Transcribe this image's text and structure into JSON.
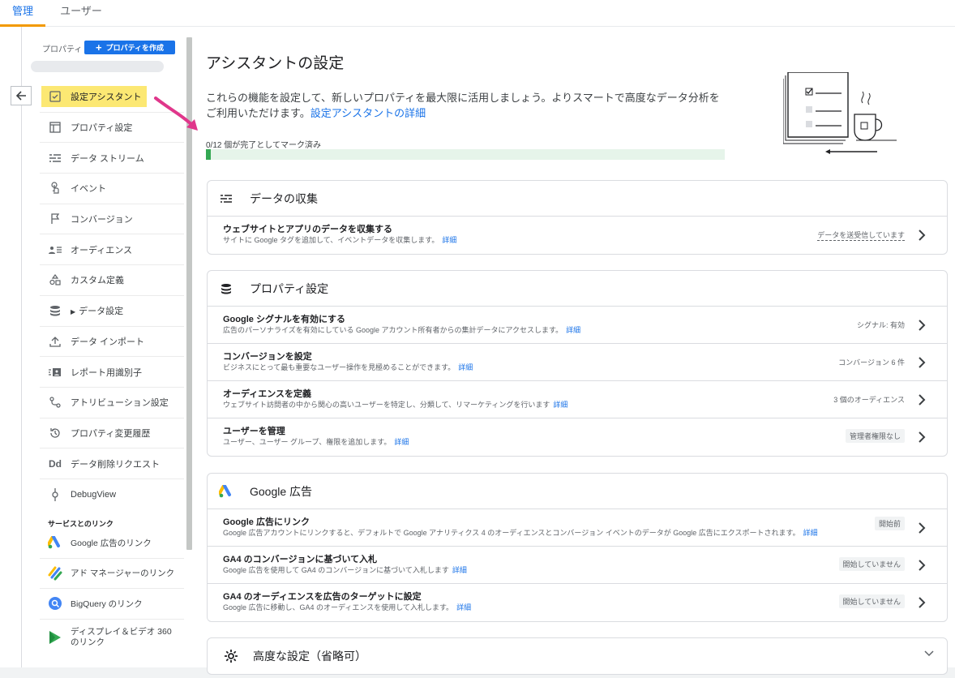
{
  "top_tabs": {
    "admin": "管理",
    "user": "ユーザー"
  },
  "sidebar": {
    "property_label": "プロパティ",
    "create_property": "プロパティを作成",
    "items": [
      {
        "label": "設定アシスタント",
        "icon": "checkbox-icon",
        "active": true
      },
      {
        "label": "プロパティ設定",
        "icon": "property-icon"
      },
      {
        "label": "データ ストリーム",
        "icon": "streams-icon"
      },
      {
        "label": "イベント",
        "icon": "touch-icon"
      },
      {
        "label": "コンバージョン",
        "icon": "flag-icon"
      },
      {
        "label": "オーディエンス",
        "icon": "audience-icon"
      },
      {
        "label": "カスタム定義",
        "icon": "shapes-icon"
      },
      {
        "label": "データ設定",
        "icon": "database-icon",
        "expandable": true
      },
      {
        "label": "データ インポート",
        "icon": "upload-icon"
      },
      {
        "label": "レポート用識別子",
        "icon": "identity-icon"
      },
      {
        "label": "アトリビューション設定",
        "icon": "attribution-icon"
      },
      {
        "label": "プロパティ変更履歴",
        "icon": "history-icon"
      },
      {
        "label": "データ削除リクエスト",
        "icon": "dd-icon"
      },
      {
        "label": "DebugView",
        "icon": "debug-icon"
      }
    ],
    "services_header": "サービスとのリンク",
    "services": [
      {
        "label": "Google 広告のリンク",
        "icon": "google-ads-icon"
      },
      {
        "label": "アド マネージャーのリンク",
        "icon": "ad-manager-icon"
      },
      {
        "label": "BigQuery のリンク",
        "icon": "bigquery-icon"
      },
      {
        "label_line1": "ディスプレイ＆ビデオ 360",
        "label_line2": "のリンク",
        "icon": "dv360-icon"
      }
    ]
  },
  "main": {
    "title": "アシスタントの設定",
    "intro_text": "これらの機能を設定して、新しいプロパティを最大限に活用しましょう。よりスマートで高度なデータ分析をご利用いただけます。",
    "intro_link": "設定アシスタントの詳細",
    "progress_label": "0/12 個が完了としてマーク済み",
    "progress_fraction": 0.01,
    "sections": {
      "collection": {
        "title": "データの収集",
        "rows": [
          {
            "title": "ウェブサイトとアプリのデータを収集する",
            "desc": "サイトに Google タグを追加して、イベントデータを収集します。",
            "link": "詳細",
            "status": "データを送受信しています"
          }
        ]
      },
      "property": {
        "title": "プロパティ設定",
        "rows": [
          {
            "title": "Google シグナルを有効にする",
            "desc": "広告のパーソナライズを有効にしている Google アカウント所有者からの集計データにアクセスします。",
            "link": "詳細",
            "status": "シグナル: 有効"
          },
          {
            "title": "コンバージョンを設定",
            "desc": "ビジネスにとって最も重要なユーザー操作を見極めることができます。",
            "link": "詳細",
            "status": "コンバージョン 6 件"
          },
          {
            "title": "オーディエンスを定義",
            "desc": "ウェブサイト訪問者の中から関心の高いユーザーを特定し、分類して、リマーケティングを行います",
            "link": "詳細",
            "status": "3 個のオーディエンス"
          },
          {
            "title": "ユーザーを管理",
            "desc": "ユーザー、ユーザー グループ、権限を追加します。",
            "link": "詳細",
            "status": "管理者権限なし"
          }
        ]
      },
      "ads": {
        "title": "Google 広告",
        "rows": [
          {
            "title": "Google 広告にリンク",
            "desc": "Google 広告アカウントにリンクすると、デフォルトで Google アナリティクス 4 のオーディエンスとコンバージョン イベントのデータが Google 広告にエクスポートされます。",
            "link": "詳細",
            "status": "開始前"
          },
          {
            "title": "GA4 のコンバージョンに基づいて入札",
            "desc": "Google 広告を使用して GA4 のコンバージョンに基づいて入札します",
            "link": "詳細",
            "status": "開始していません"
          },
          {
            "title": "GA4 のオーディエンスを広告のターゲットに設定",
            "desc": "Google 広告に移動し、GA4 のオーディエンスを使用して入札します。",
            "link": "詳細",
            "status": "開始していません"
          }
        ]
      },
      "advanced": {
        "title": "高度な設定（省略可）"
      }
    }
  }
}
